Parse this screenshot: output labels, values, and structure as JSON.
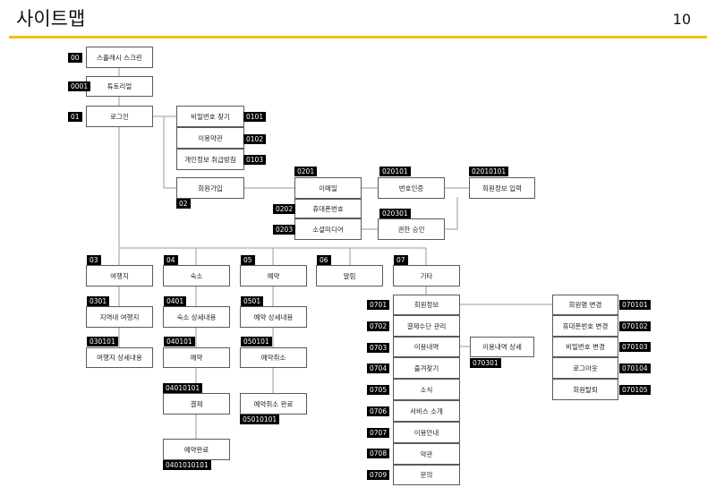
{
  "header": {
    "title": "사이트맵",
    "page_number": "10"
  },
  "nodes": [
    {
      "id": "splash",
      "label": "스플래시 스크린",
      "code": "00"
    },
    {
      "id": "tutorial",
      "label": "튜토리얼",
      "code": "0001"
    },
    {
      "id": "login",
      "label": "로그인",
      "code": "01"
    },
    {
      "id": "find-password",
      "label": "비밀번호 찾기",
      "code": "0101"
    },
    {
      "id": "terms",
      "label": "이용약관",
      "code": "0102"
    },
    {
      "id": "privacy",
      "label": "개인정보 취급방침",
      "code": "0103"
    },
    {
      "id": "signup",
      "label": "회원가입",
      "code": "02"
    },
    {
      "id": "email",
      "label": "이메일",
      "code": "0201"
    },
    {
      "id": "phone",
      "label": "휴대폰번호",
      "code": "0202"
    },
    {
      "id": "social",
      "label": "소셜미디어",
      "code": "0203"
    },
    {
      "id": "verify",
      "label": "번호인증",
      "code": "020101"
    },
    {
      "id": "member-info-input",
      "label": "회원정보 입력",
      "code": "02010101"
    },
    {
      "id": "permission",
      "label": "권한 승인",
      "code": "020301"
    },
    {
      "id": "destination",
      "label": "여행지",
      "code": "03"
    },
    {
      "id": "region-destination",
      "label": "지역내 여행지",
      "code": "0301"
    },
    {
      "id": "destination-detail",
      "label": "여행지 상세내용",
      "code": "030101"
    },
    {
      "id": "lodging",
      "label": "숙소",
      "code": "04"
    },
    {
      "id": "lodging-detail",
      "label": "숙소 상세내용",
      "code": "0401"
    },
    {
      "id": "lodging-reserve",
      "label": "예약",
      "code": "040101"
    },
    {
      "id": "payment",
      "label": "결제",
      "code": "04010101"
    },
    {
      "id": "reserve-complete",
      "label": "예약완료",
      "code": "0401010101"
    },
    {
      "id": "reservation",
      "label": "예약",
      "code": "05"
    },
    {
      "id": "reservation-detail",
      "label": "예약 상세내용",
      "code": "0501"
    },
    {
      "id": "reservation-cancel",
      "label": "예약취소",
      "code": "050101"
    },
    {
      "id": "cancel-complete",
      "label": "예약취소 완료",
      "code": "05010101"
    },
    {
      "id": "notification",
      "label": "알림",
      "code": "06"
    },
    {
      "id": "etc",
      "label": "기타",
      "code": "07"
    },
    {
      "id": "member-info",
      "label": "회원정보",
      "code": "0701"
    },
    {
      "id": "payment-method",
      "label": "결제수단 관리",
      "code": "0702"
    },
    {
      "id": "history",
      "label": "이용내역",
      "code": "0703"
    },
    {
      "id": "history-detail",
      "label": "이용내역 상세",
      "code": "070301"
    },
    {
      "id": "favorites",
      "label": "즐겨찾기",
      "code": "0704"
    },
    {
      "id": "news",
      "label": "소식",
      "code": "0705"
    },
    {
      "id": "service-intro",
      "label": "서비스 소개",
      "code": "0706"
    },
    {
      "id": "guide",
      "label": "이용안내",
      "code": "0707"
    },
    {
      "id": "policy",
      "label": "약관",
      "code": "0708"
    },
    {
      "id": "inquiry",
      "label": "문의",
      "code": "0709"
    },
    {
      "id": "change-name",
      "label": "회원명 변경",
      "code": "070101"
    },
    {
      "id": "change-phone",
      "label": "휴대폰번호 변경",
      "code": "070102"
    },
    {
      "id": "change-password",
      "label": "비밀번호 변경",
      "code": "070103"
    },
    {
      "id": "logout",
      "label": "로그아웃",
      "code": "070104"
    },
    {
      "id": "withdraw",
      "label": "회원탈퇴",
      "code": "070105"
    }
  ]
}
